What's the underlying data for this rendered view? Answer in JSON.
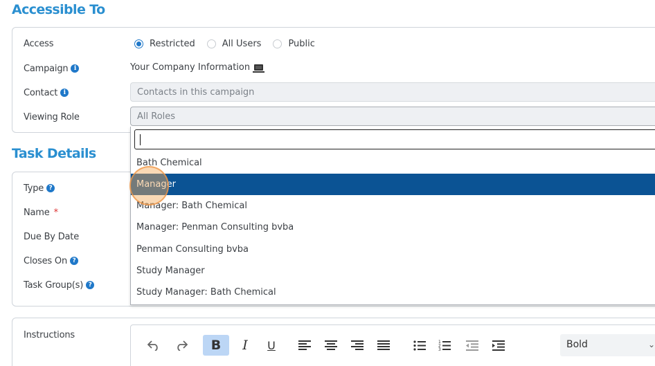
{
  "accessible_to": {
    "title": "Accessible To",
    "access_label": "Access",
    "access_options": [
      "Restricted",
      "All Users",
      "Public"
    ],
    "access_selected": "Restricted",
    "campaign_label": "Campaign",
    "campaign_value": "Your Company Information",
    "contact_label": "Contact",
    "contact_value": "Contacts in this campaign",
    "viewing_role_label": "Viewing Role",
    "viewing_role_value": "All Roles"
  },
  "dropdown": {
    "search_value": "",
    "options": [
      "Bath Chemical",
      "Manager",
      "Manager: Bath Chemical",
      "Manager: Penman Consulting bvba",
      "Penman Consulting bvba",
      "Study Manager",
      "Study Manager: Bath Chemical"
    ],
    "highlighted": "Manager"
  },
  "task_details": {
    "title": "Task Details",
    "type_label": "Type",
    "name_label": "Name",
    "required_mark": "*",
    "due_by_date_label": "Due By Date",
    "closes_on_label": "Closes On",
    "task_groups_label": "Task Group(s)"
  },
  "instructions": {
    "label": "Instructions",
    "format_value": "Bold",
    "toolbar_icons": [
      "undo-icon",
      "redo-icon",
      "bold-icon",
      "italic-icon",
      "underline-icon",
      "align-left-icon",
      "align-center-icon",
      "align-right-icon",
      "align-justify-icon",
      "bullet-list-icon",
      "numbered-list-icon",
      "outdent-icon",
      "indent-icon"
    ]
  },
  "colors": {
    "heading": "#2a8fd0",
    "highlight": "#0b5394",
    "accent": "#1f78c9"
  }
}
